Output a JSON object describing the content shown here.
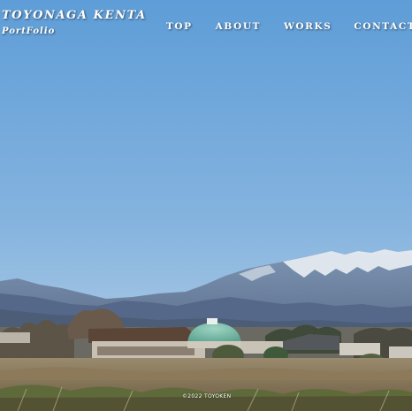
{
  "brand": {
    "name": "TOYONAGA KENTA",
    "subtitle": "PortFolio"
  },
  "nav": {
    "top": "TOP",
    "about": "ABOUT",
    "works": "WORKS",
    "contact": "CONTACT"
  },
  "footer": {
    "copyright": "©2022 TOYOKEN"
  },
  "colors": {
    "sky_top": "#5f9fd8",
    "sky_bottom": "#b9d3e8",
    "mountains": "#5f7fa3",
    "snow": "#e9eef3"
  }
}
